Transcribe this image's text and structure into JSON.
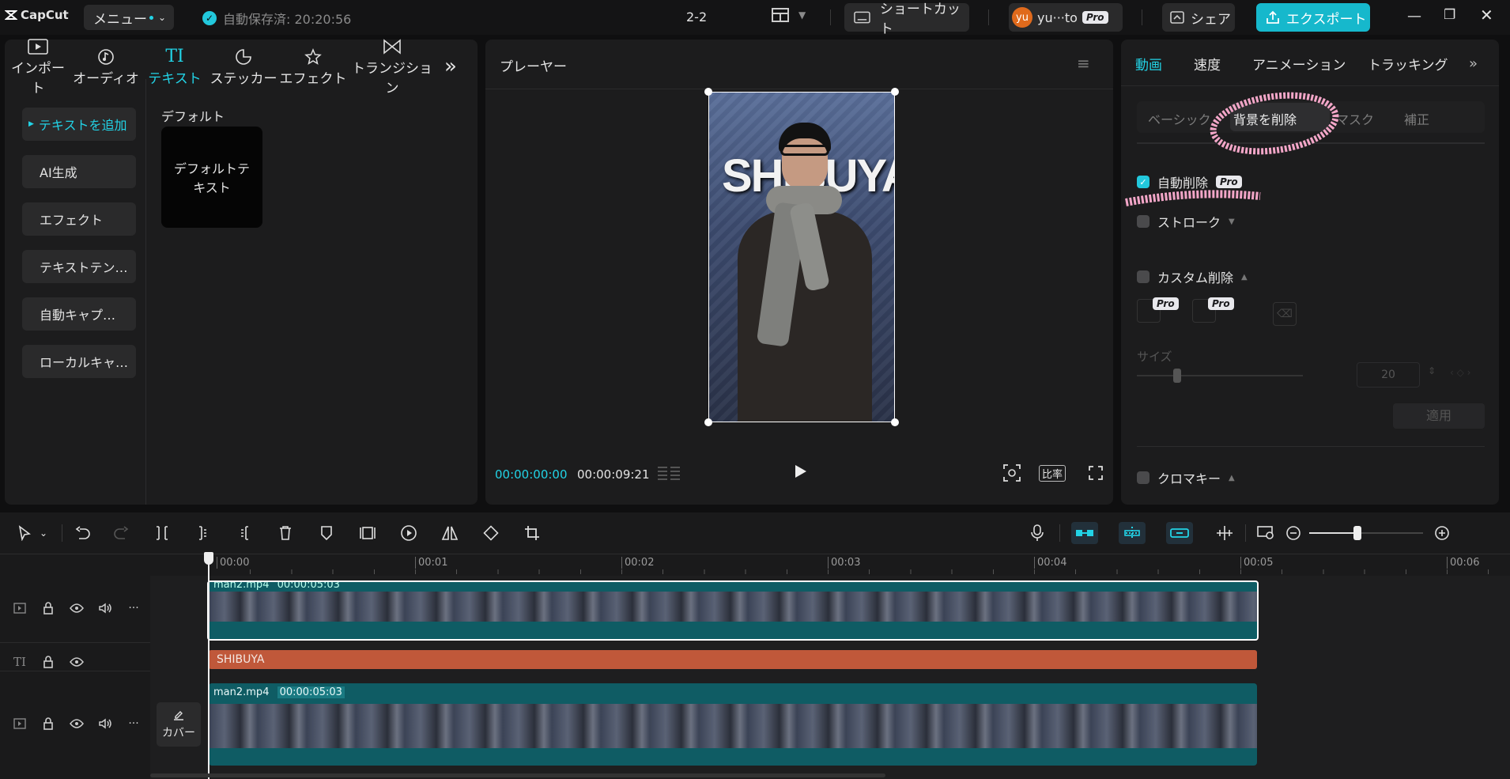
{
  "app": {
    "logo": "CapCut",
    "menu_label": "メニュー",
    "autosave": "自動保存済: 20:20:56",
    "project_name": "2-2",
    "shortcut_label": "ショートカット",
    "user_name": "yu···to",
    "user_avatar_text": "yu",
    "pro_badge": "Pro",
    "share_label": "シェア",
    "export_label": "エクスポート"
  },
  "media_tabs": [
    {
      "label": "インポート",
      "icon": "import-icon"
    },
    {
      "label": "オーディオ",
      "icon": "audio-icon"
    },
    {
      "label": "テキスト",
      "icon": "text-icon"
    },
    {
      "label": "ステッカー",
      "icon": "sticker-icon"
    },
    {
      "label": "エフェクト",
      "icon": "effect-icon"
    },
    {
      "label": "トランジション",
      "icon": "transition-icon"
    }
  ],
  "text_sidebar": [
    {
      "label": "テキストを追加"
    },
    {
      "label": "AI生成"
    },
    {
      "label": "エフェクト"
    },
    {
      "label": "テキストテン…"
    },
    {
      "label": "自動キャプ…"
    },
    {
      "label": "ローカルキャ…"
    }
  ],
  "text_library": {
    "section_title": "デフォルト",
    "default_card": "デフォルトテキスト"
  },
  "player": {
    "title": "プレーヤー",
    "current_time": "00:00:00:00",
    "total_time": "00:00:09:21",
    "ratio_label": "比率",
    "overlay_text": "SHIBUYA"
  },
  "inspector": {
    "tabs": [
      "動画",
      "速度",
      "アニメーション",
      "トラッキング"
    ],
    "subtabs": [
      "ベーシック",
      "背景を削除",
      "マスク",
      "補正"
    ],
    "auto_remove": "自動削除",
    "stroke": "ストローク",
    "custom_remove": "カスタム削除",
    "size_label": "サイズ",
    "size_value": "20",
    "apply_label": "適用",
    "chroma_key": "クロマキー"
  },
  "timeline": {
    "ruler": [
      "00:00",
      "00:01",
      "00:02",
      "00:03",
      "00:04",
      "00:05",
      "00:06"
    ],
    "text_clip": "SHIBUYA",
    "main_clip_name": "man2.mp4",
    "main_clip_duration": "00:00:05:03",
    "cover_label": "カバー",
    "overlay_clip_name": "man2.mp4",
    "overlay_clip_duration": "00:00:05:03"
  },
  "colors": {
    "accent": "#22d3e6",
    "clip_teal": "#0f5c64",
    "text_clip": "#c0583a",
    "annotation_pink": "#f3a6c8"
  }
}
